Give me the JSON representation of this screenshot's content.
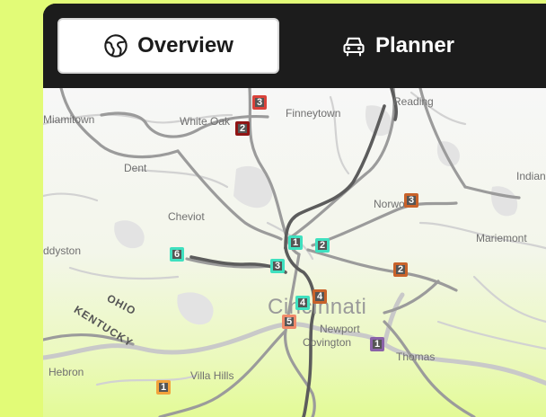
{
  "tabs": [
    {
      "label": "Overview",
      "icon": "globe-icon",
      "active": true
    },
    {
      "label": "Planner",
      "icon": "car-icon",
      "active": false
    }
  ],
  "places": {
    "reading": "Reading",
    "miamitown": "Miamitown",
    "white_oak": "White Oak",
    "finneytown": "Finneytown",
    "dent": "Dent",
    "indian_hill": "Indian",
    "cheviot": "Cheviot",
    "norwood": "Norwo",
    "addyston": "ddyston",
    "mariemont": "Mariemont",
    "ohio": "OHIO",
    "kentucky": "KENTUCKY",
    "cincinnati": "Cincinnati",
    "newport": "Newport",
    "covington": "Covington",
    "fort_thomas": "Thomas",
    "hebron": "Hebron",
    "villa_hills": "Villa Hills"
  },
  "markers": [
    {
      "label": "3",
      "color": "#d9433b"
    },
    {
      "label": "2",
      "color": "#8f1414"
    },
    {
      "label": "3",
      "color": "#c8622a"
    },
    {
      "label": "6",
      "color": "#3fe0bf"
    },
    {
      "label": "1",
      "color": "#3fe0bf"
    },
    {
      "label": "2",
      "color": "#3fe0bf"
    },
    {
      "label": "3",
      "color": "#3fe0bf"
    },
    {
      "label": "2",
      "color": "#c8622a"
    },
    {
      "label": "4",
      "color": "#3fe0bf"
    },
    {
      "label": "4",
      "color": "#c8622a"
    },
    {
      "label": "5",
      "color": "#f08a6a"
    },
    {
      "label": "1",
      "color": "#8a62a8"
    },
    {
      "label": "1",
      "color": "#f2a33c"
    }
  ],
  "colors": {
    "page_background": "#e2fb77",
    "tab_bar": "#1c1c1c",
    "active_tab": "#ffffff"
  }
}
